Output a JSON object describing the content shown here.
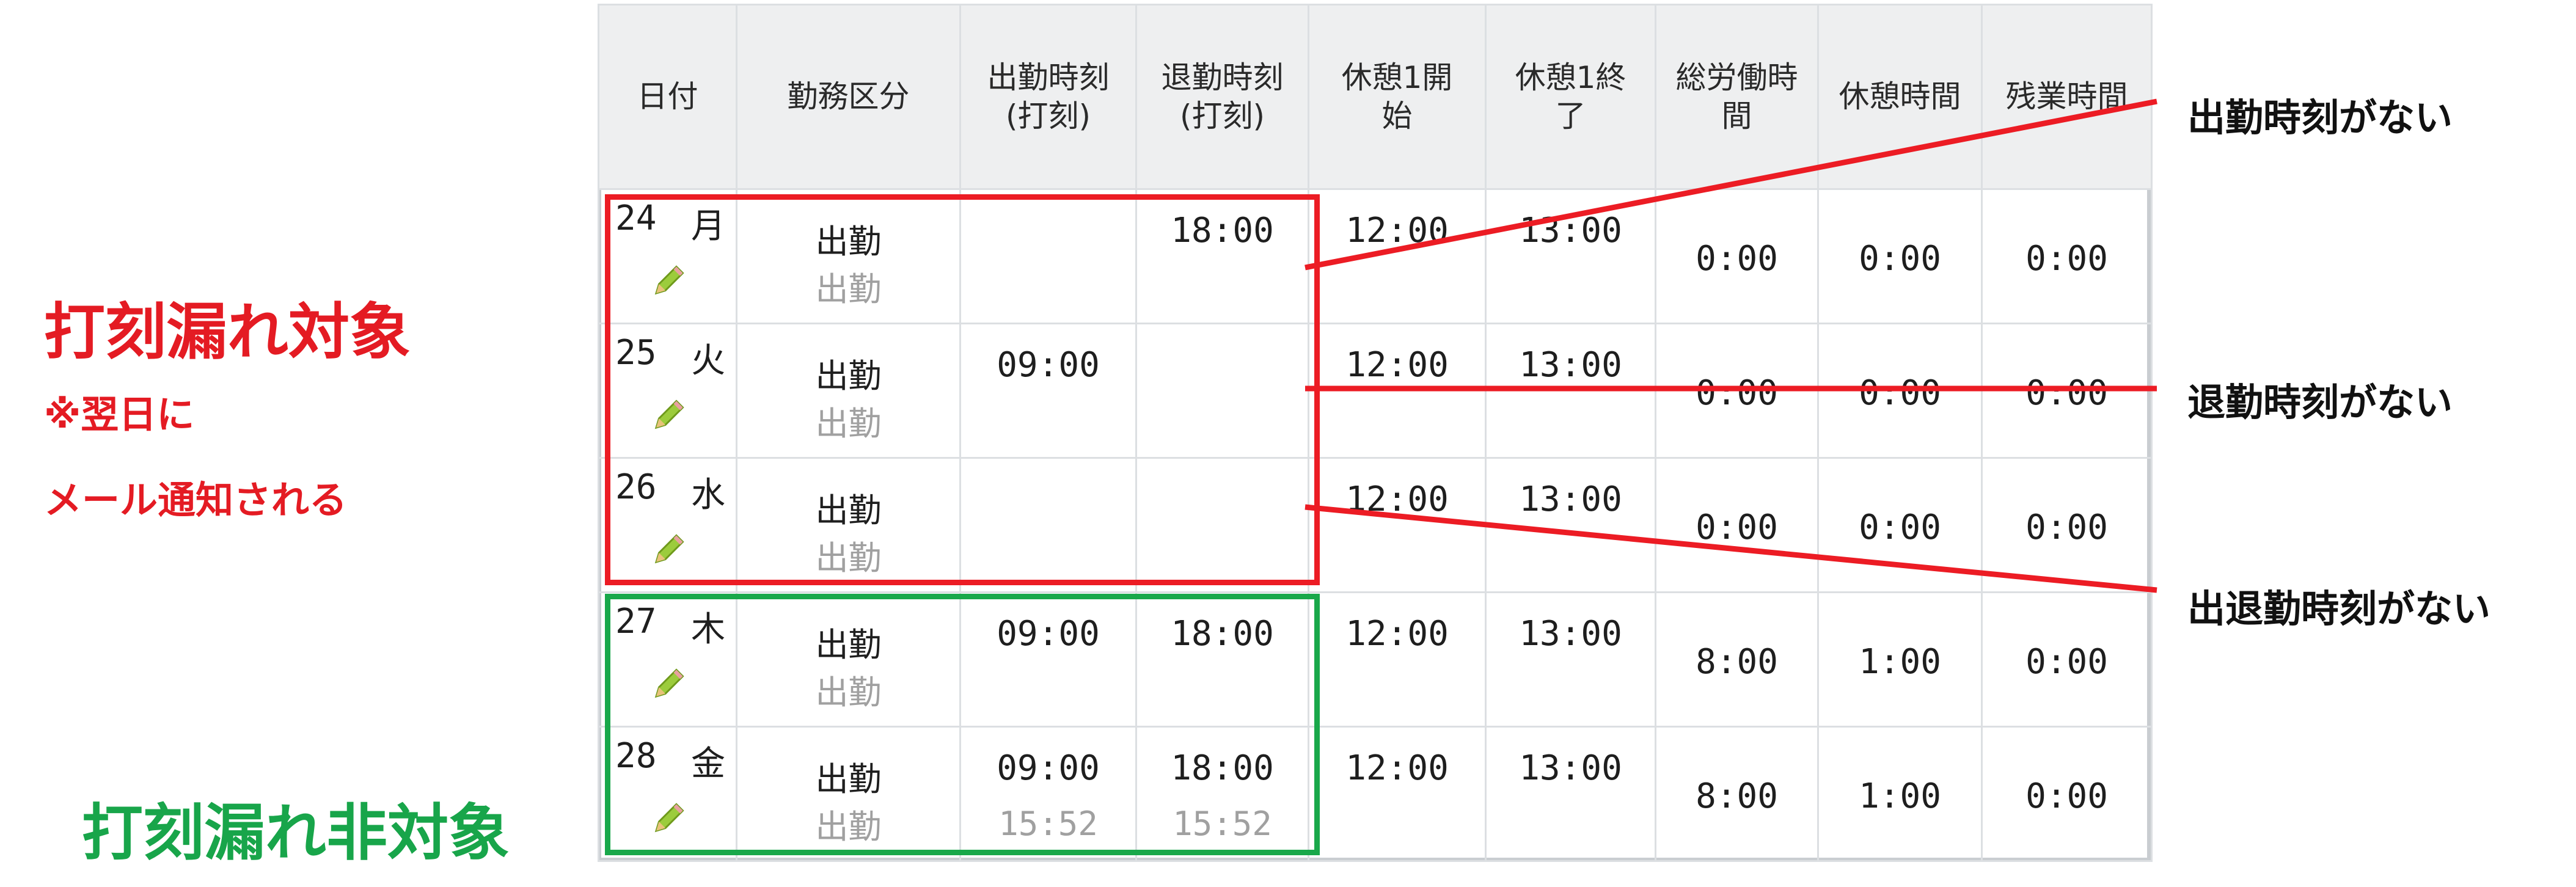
{
  "table": {
    "headers": [
      {
        "line1": "日付",
        "line2": ""
      },
      {
        "line1": "勤務区分",
        "line2": ""
      },
      {
        "line1": "出勤時刻",
        "line2": "(打刻)"
      },
      {
        "line1": "退勤時刻",
        "line2": "(打刻)"
      },
      {
        "line1": "休憩1開",
        "line2": "始"
      },
      {
        "line1": "休憩1終",
        "line2": "了"
      },
      {
        "line1": "総労働時",
        "line2": "間"
      },
      {
        "line1": "休憩時間",
        "line2": ""
      },
      {
        "line1": "残業時間",
        "line2": ""
      }
    ],
    "rows": [
      {
        "day": "24",
        "dow": "月",
        "kubun": "出勤",
        "kubun_sub": "出勤",
        "in": "",
        "in_sub": "",
        "out": "18:00",
        "out_sub": "",
        "b_start": "12:00",
        "b_end": "13:00",
        "total": "0:00",
        "break": "0:00",
        "overtime": "0:00"
      },
      {
        "day": "25",
        "dow": "火",
        "kubun": "出勤",
        "kubun_sub": "出勤",
        "in": "09:00",
        "in_sub": "",
        "out": "",
        "out_sub": "",
        "b_start": "12:00",
        "b_end": "13:00",
        "total": "0:00",
        "break": "0:00",
        "overtime": "0:00"
      },
      {
        "day": "26",
        "dow": "水",
        "kubun": "出勤",
        "kubun_sub": "出勤",
        "in": "",
        "in_sub": "",
        "out": "",
        "out_sub": "",
        "b_start": "12:00",
        "b_end": "13:00",
        "total": "0:00",
        "break": "0:00",
        "overtime": "0:00"
      },
      {
        "day": "27",
        "dow": "木",
        "kubun": "出勤",
        "kubun_sub": "出勤",
        "in": "09:00",
        "in_sub": "",
        "out": "18:00",
        "out_sub": "",
        "b_start": "12:00",
        "b_end": "13:00",
        "total": "8:00",
        "break": "1:00",
        "overtime": "0:00"
      },
      {
        "day": "28",
        "dow": "金",
        "kubun": "出勤",
        "kubun_sub": "出勤",
        "in": "09:00",
        "in_sub": "15:52",
        "out": "18:00",
        "out_sub": "15:52",
        "b_start": "12:00",
        "b_end": "13:00",
        "total": "8:00",
        "break": "1:00",
        "overtime": "0:00"
      }
    ]
  },
  "icons": {
    "edit": "pencil-icon"
  },
  "annotations": {
    "missing_in": "出勤時刻がない",
    "missing_out": "退勤時刻がない",
    "missing_both": "出退勤時刻がない",
    "target_title": "打刻漏れ対象",
    "target_note_1": "※翌日に",
    "target_note_2": "メール通知される",
    "non_target_title": "打刻漏れ非対象"
  },
  "colors": {
    "target": "#ec1c24",
    "non_target": "#19a84a",
    "header_bg": "#eeeff0",
    "grid": "#dcdfe2",
    "sub_text": "#a0a0a0"
  }
}
